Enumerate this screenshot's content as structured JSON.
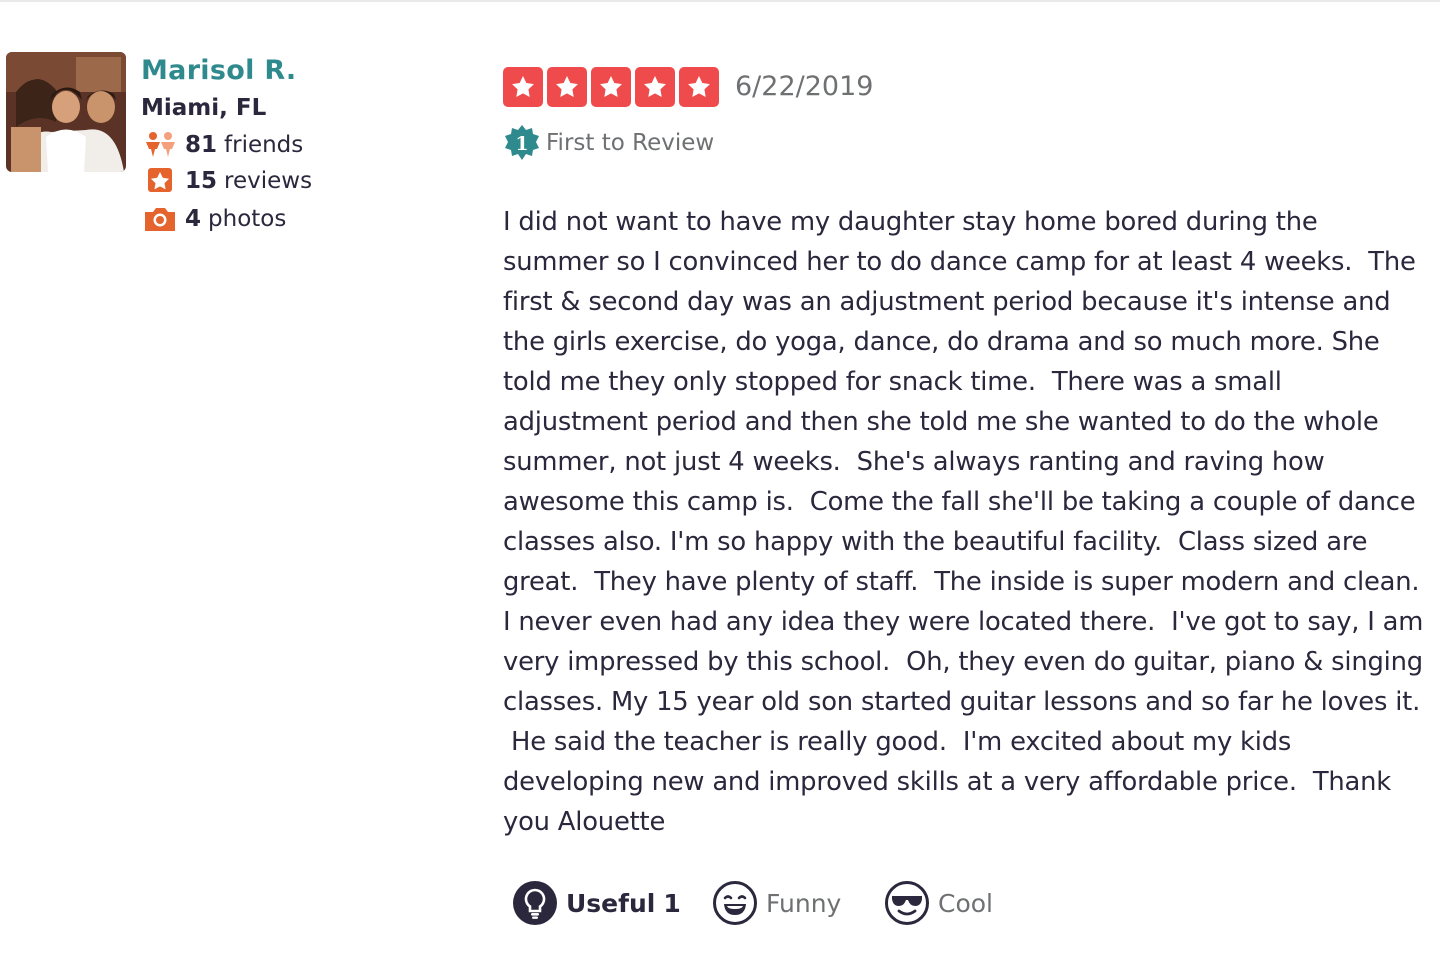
{
  "user": {
    "name": "Marisol R.",
    "location": "Miami, FL",
    "stats": {
      "friends": {
        "count": "81",
        "label": "friends",
        "icon": "friends-icon"
      },
      "reviews": {
        "count": "15",
        "label": "reviews",
        "icon": "star-icon"
      },
      "photos": {
        "count": "4",
        "label": "photos",
        "icon": "camera-icon"
      }
    }
  },
  "review": {
    "rating": 5,
    "rating_max": 5,
    "date": "6/22/2019",
    "badge_number": "1",
    "badge_label": "First to Review",
    "text": "I did not want to have my daughter stay home bored during the\nsummer so I convinced her to do dance camp for at least 4 weeks.  The\nfirst & second day was an adjustment period because it's intense and\nthe girls exercise, do yoga, dance, do drama and so much more. She\ntold me they only stopped for snack time.  There was a small\nadjustment period and then she told me she wanted to do the whole\nsummer, not just 4 weeks.  She's always ranting and raving how\nawesome this camp is.  Come the fall she'll be taking a couple of dance\nclasses also. I'm so happy with the beautiful facility.  Class sized are\ngreat.  They have plenty of staff.  The inside is super modern and clean.\nI never even had any idea they were located there.  I've got to say, I am\nvery impressed by this school.  Oh, they even do guitar, piano & singing\nclasses. My 15 year old son started guitar lessons and so far he loves it.\n He said the teacher is really good.  I'm excited about my kids\ndeveloping new and improved skills at a very affordable price.  Thank\nyou Alouette"
  },
  "reactions": {
    "useful": {
      "label": "Useful",
      "count": "1",
      "icon": "lightbulb-icon"
    },
    "funny": {
      "label": "Funny",
      "icon": "laughing-face-icon"
    },
    "cool": {
      "label": "Cool",
      "icon": "sunglasses-face-icon"
    }
  },
  "colors": {
    "star": "#ef4b4c",
    "name_link": "#2f8a8d",
    "stat_icon": "#e5632c",
    "badge": "#2f8a8d",
    "text": "#2b273c",
    "muted": "#6e7072"
  }
}
